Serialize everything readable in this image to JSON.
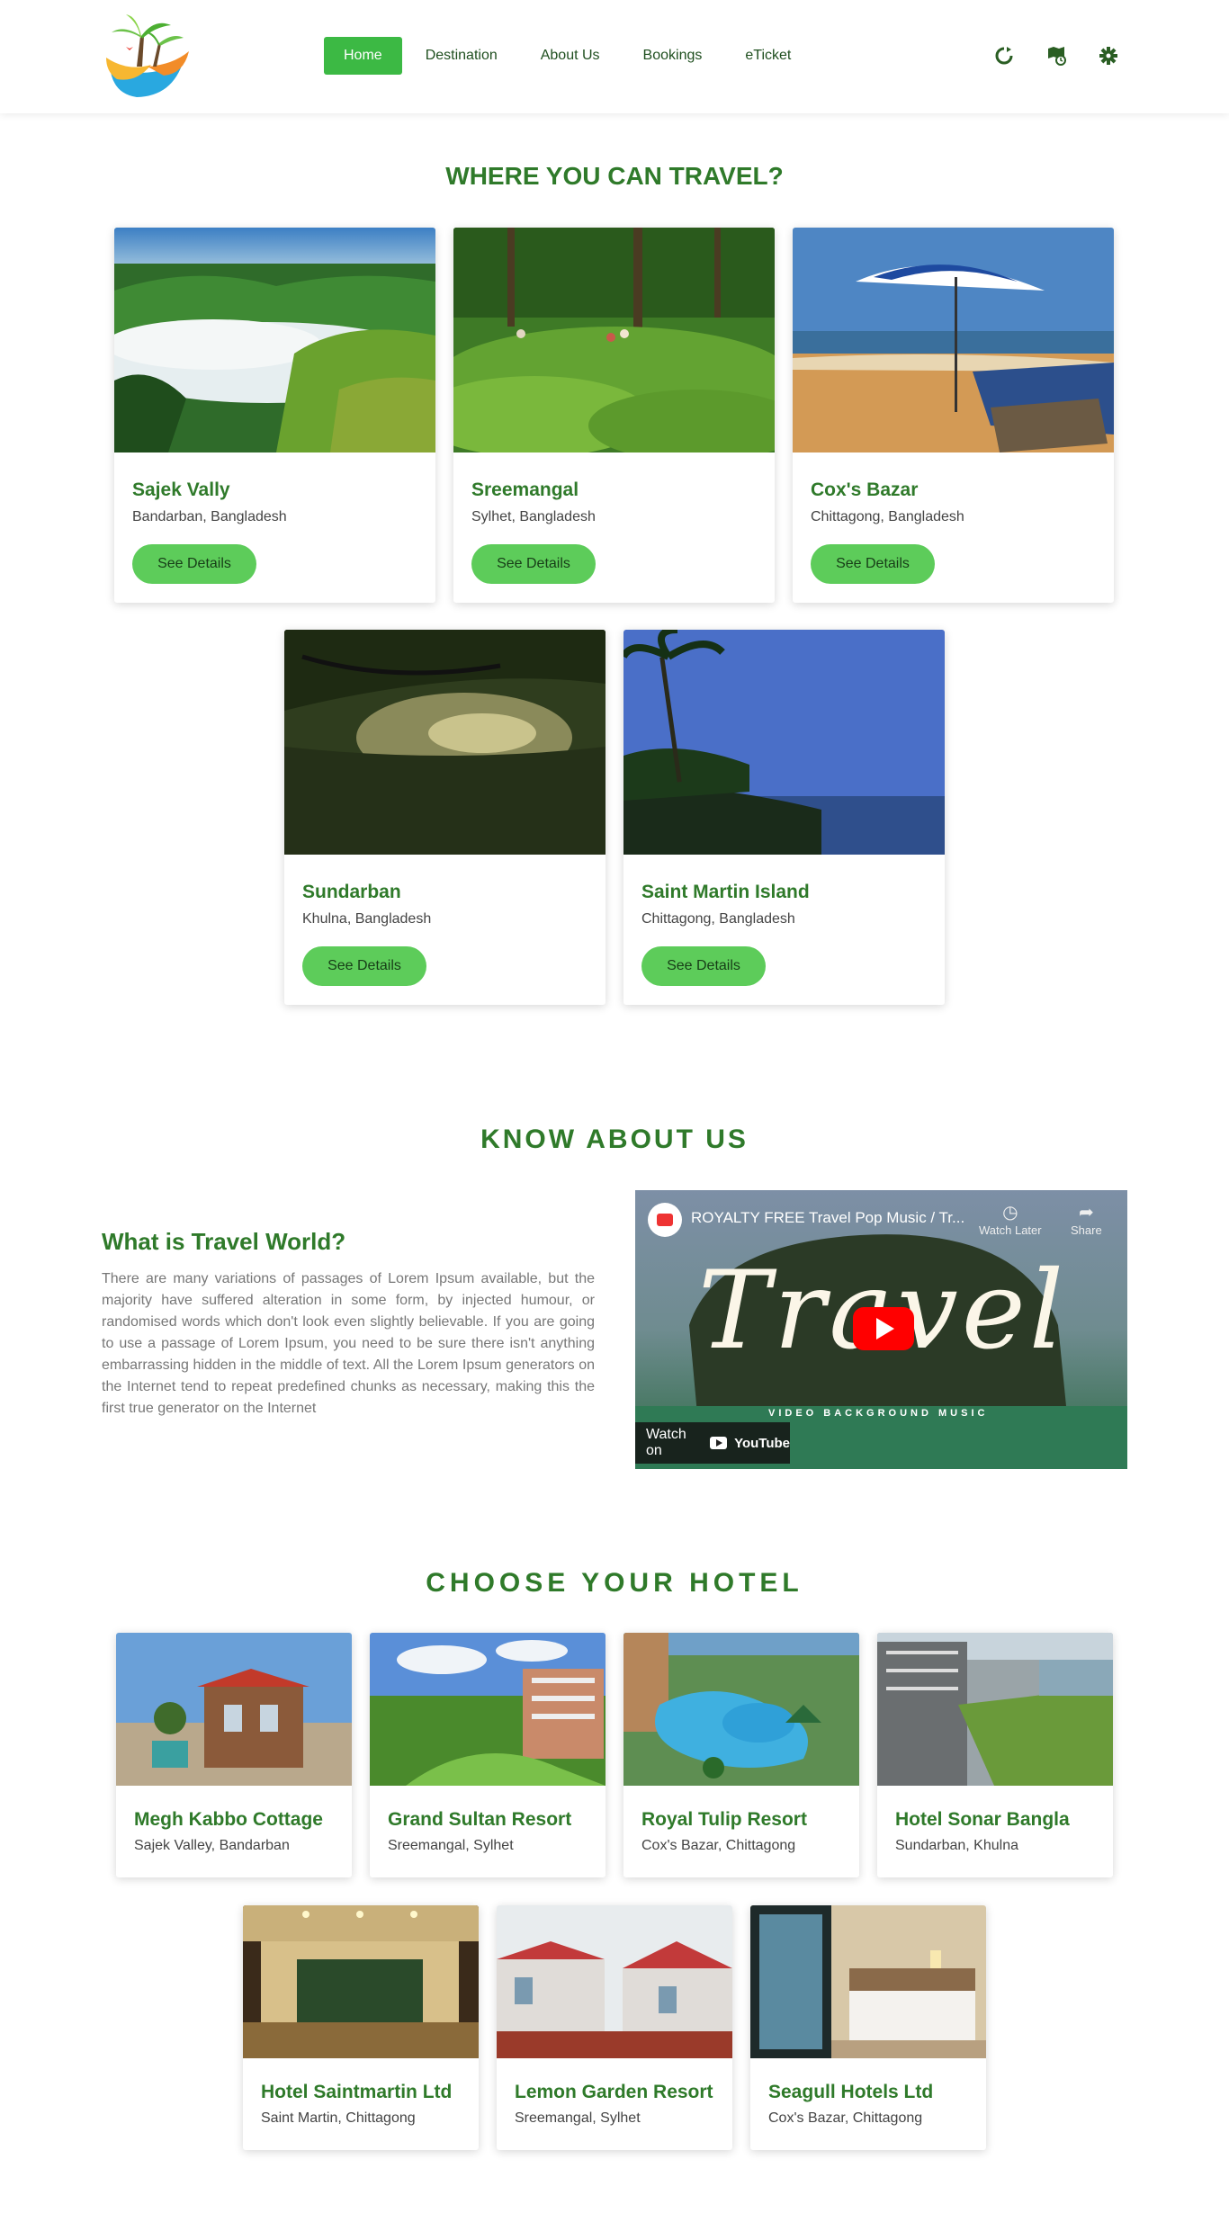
{
  "nav": {
    "links": [
      "Home",
      "Destination",
      "About Us",
      "Bookings",
      "eTicket"
    ],
    "icons": [
      "refresh-icon",
      "map-icon",
      "gear-icon"
    ]
  },
  "destinations": {
    "title": "WHERE YOU CAN TRAVEL?",
    "button_label": "See Details",
    "items": [
      {
        "name": "Sajek Vally",
        "location": "Bandarban, Bangladesh"
      },
      {
        "name": "Sreemangal",
        "location": "Sylhet, Bangladesh"
      },
      {
        "name": "Cox's Bazar",
        "location": "Chittagong, Bangladesh"
      },
      {
        "name": "Sundarban",
        "location": "Khulna, Bangladesh"
      },
      {
        "name": "Saint Martin Island",
        "location": "Chittagong, Bangladesh"
      }
    ]
  },
  "about": {
    "title": "KNOW ABOUT US",
    "heading": "What is Travel World?",
    "text": "There are many variations of passages of Lorem Ipsum available, but the majority have suffered alteration in some form, by injected humour, or randomised words which don't look even slightly believable. If you are going to use a passage of Lorem Ipsum, you need to be sure there isn't anything embarrassing hidden in the middle of text. All the Lorem Ipsum generators on the Internet tend to repeat predefined chunks as necessary, making this the first true generator on the Internet",
    "video": {
      "title": "ROYALTY FREE Travel Pop Music / Tr...",
      "watch_later": "Watch Later",
      "share": "Share",
      "big_word": "Travel",
      "subtitle": "VIDEO BACKGROUND MUSIC",
      "watch_on": "Watch on",
      "youtube": "YouTube"
    }
  },
  "hotels": {
    "title": "CHOOSE YOUR HOTEL",
    "items": [
      {
        "name": "Megh Kabbo Cottage",
        "location": "Sajek Valley, Bandarban"
      },
      {
        "name": "Grand Sultan Resort",
        "location": "Sreemangal, Sylhet"
      },
      {
        "name": "Royal Tulip Resort",
        "location": "Cox's Bazar, Chittagong"
      },
      {
        "name": "Hotel Sonar Bangla",
        "location": "Sundarban, Khulna"
      },
      {
        "name": "Hotel Saintmartin Ltd",
        "location": "Saint Martin, Chittagong"
      },
      {
        "name": "Lemon Garden Resort",
        "location": "Sreemangal, Sylhet"
      },
      {
        "name": "Seagull Hotels Ltd",
        "location": "Cox's Bazar, Chittagong"
      }
    ]
  },
  "colors": {
    "brand_green": "#2f7a2a",
    "nav_active": "#3cb944",
    "button_green": "#5dcc5a"
  }
}
